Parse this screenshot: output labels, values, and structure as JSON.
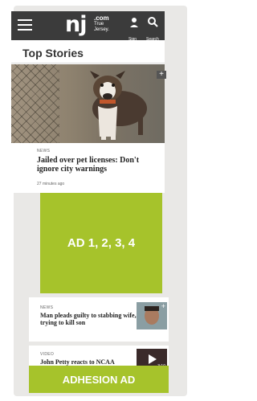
{
  "header": {
    "logo_main": "nj",
    "logo_com": ".com",
    "logo_sub": "True Jersey.",
    "sign_in_label": "Sign In",
    "search_label": "Search"
  },
  "section": {
    "title": "Top Stories"
  },
  "lead_story": {
    "kicker": "NEWS",
    "headline": "Jailed over pet licenses: Don't ignore city warnings",
    "timestamp": "27 minutes ago",
    "photo_badge": "+"
  },
  "ad": {
    "label": "AD 1, 2, 3, 4",
    "color": "#a6c32b"
  },
  "story2": {
    "kicker": "NEWS",
    "headline": "Man pleads guilty to stabbing wife, trying to kill son",
    "thumb_badge": "+"
  },
  "story3": {
    "kicker": "VIDEO",
    "headline": "John Petty reacts to NCAA",
    "duration": "3:10"
  },
  "adhesion": {
    "label": "ADHESION AD",
    "color": "#a6c32b"
  }
}
